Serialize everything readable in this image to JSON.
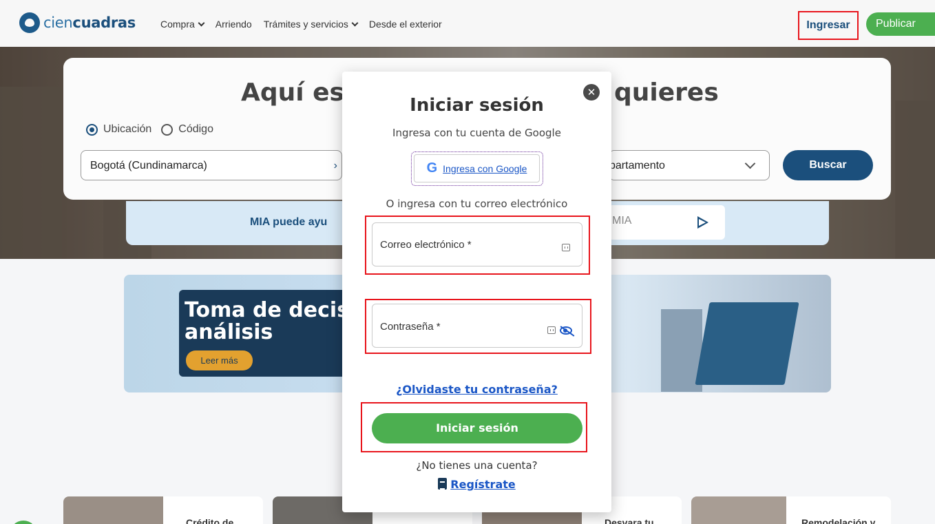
{
  "navbar": {
    "logo_part1": "cien",
    "logo_part2": "cuadras",
    "items": [
      {
        "label": "Compra"
      },
      {
        "label": "Arriendo"
      },
      {
        "label": "Trámites y servicios"
      },
      {
        "label": "Desde el exterior"
      }
    ],
    "login": "Ingresar",
    "publish": "Publicar"
  },
  "search": {
    "title_left": "Aquí es",
    "title_right": "quieres",
    "radio_location": "Ubicación",
    "radio_code": "Código",
    "location_value": "Bogotá (Cundinamarca)",
    "type_value": "partamento",
    "search_button": "Buscar"
  },
  "mia": {
    "text": "MIA puede ayu",
    "input_placeholder": "MIA"
  },
  "banner": {
    "title": "Toma de decisi y análisis",
    "read_more": "Leer más"
  },
  "cards": [
    {
      "label": "Crédito de"
    },
    {
      "label": ""
    },
    {
      "label": "Desvara tu"
    },
    {
      "label": "Remodelación y"
    }
  ],
  "modal": {
    "title": "Iniciar sesión",
    "google_subtitle": "Ingresa con tu cuenta de Google",
    "google_button": "Ingresa con Google",
    "google_letter": "G",
    "email_alt": "O ingresa con tu correo electrónico",
    "email_placeholder": "Correo electrónico *",
    "password_placeholder": "Contraseña *",
    "forgot": "¿Olvidaste tu contraseña?",
    "login_button": "Iniciar sesión",
    "no_account": "¿No tienes una cuenta?",
    "register": "Regístrate",
    "close_symbol": "✕"
  },
  "colors": {
    "brand_blue": "#1b4f7c",
    "link_blue": "#1a56c6",
    "green": "#4caf50",
    "highlight_red": "#e8141b"
  }
}
